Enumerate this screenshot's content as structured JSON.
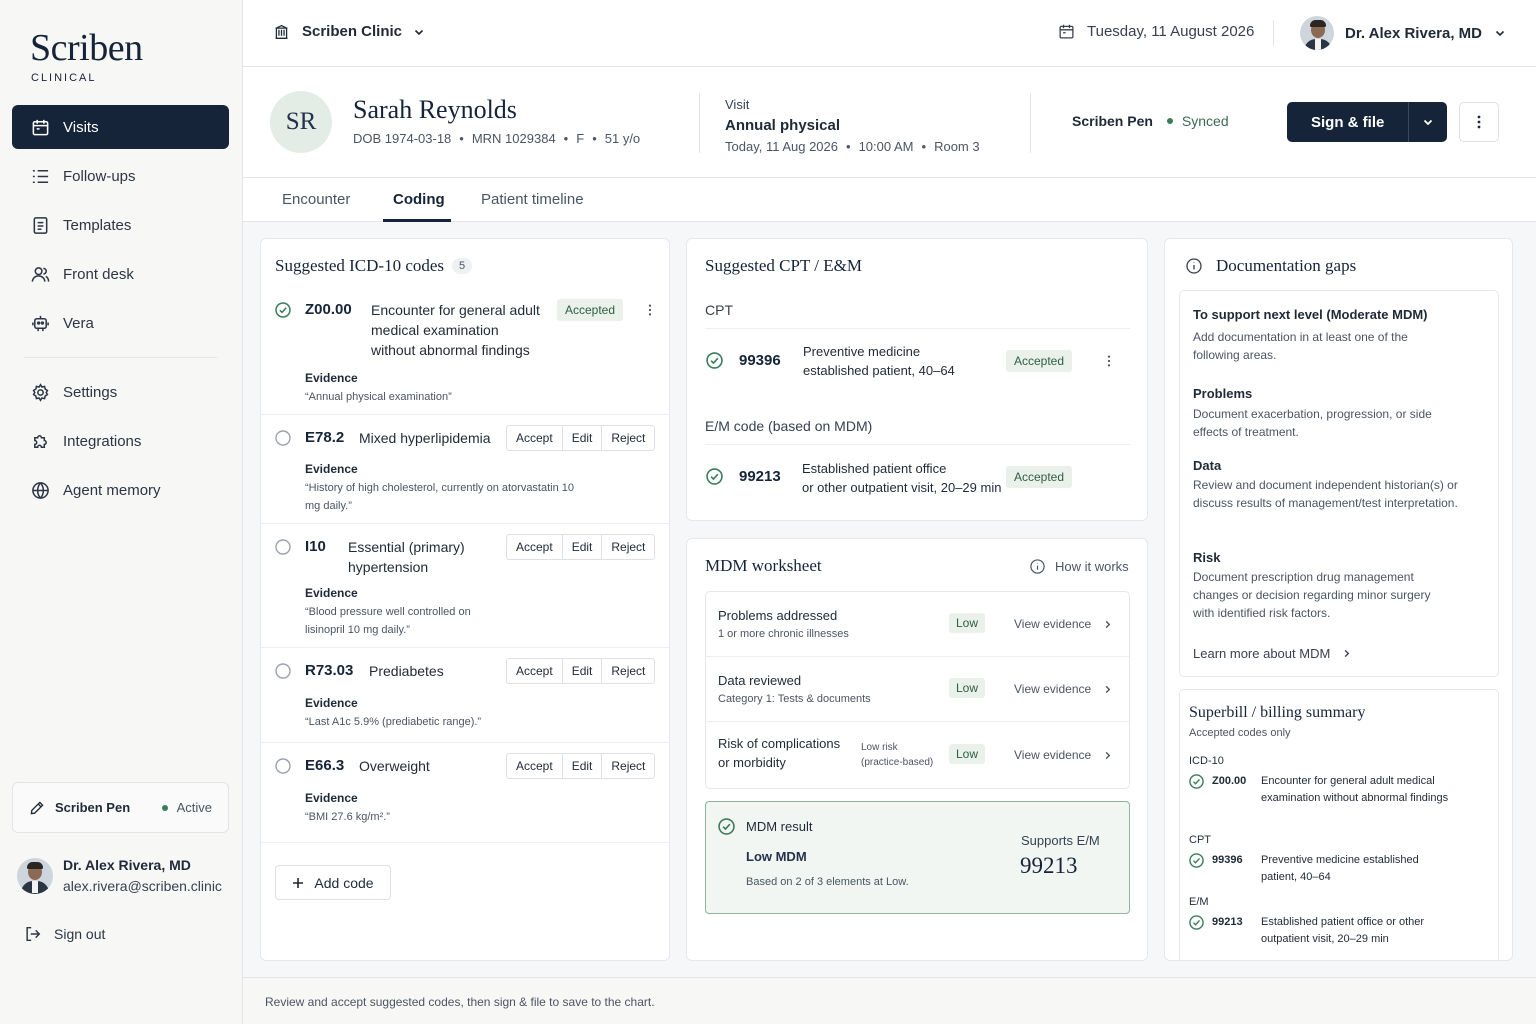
{
  "brand": {
    "name": "Scriben",
    "subtitle": "CLINICAL"
  },
  "sidebar": {
    "items": [
      {
        "label": "Visits",
        "icon": "calendar-icon"
      },
      {
        "label": "Follow-ups",
        "icon": "list-icon"
      },
      {
        "label": "Templates",
        "icon": "document-icon"
      },
      {
        "label": "Front desk",
        "icon": "users-icon"
      },
      {
        "label": "Vera",
        "icon": "robot-icon"
      },
      {
        "label": "Settings",
        "icon": "gear-icon"
      },
      {
        "label": "Integrations",
        "icon": "puzzle-icon"
      },
      {
        "label": "Agent memory",
        "icon": "globe-icon"
      }
    ],
    "pen": {
      "name": "Scriben Pen",
      "status": "Active"
    },
    "user": {
      "name": "Dr. Alex Rivera, MD",
      "email": "alex.rivera@scriben.clinic"
    },
    "signout": "Sign out"
  },
  "topbar": {
    "clinic": "Scriben Clinic",
    "date": "Tuesday, 11 August 2026",
    "user": "Dr. Alex Rivera, MD"
  },
  "patient": {
    "initials": "SR",
    "name": "Sarah Reynolds",
    "dob": "DOB 1974-03-18",
    "mrn": "MRN 1029384",
    "sex": "F",
    "age": "51 y/o",
    "visit_label": "Visit",
    "visit_type": "Annual physical",
    "visit_date": "Today, 11 Aug 2026",
    "visit_time": "10:00 AM",
    "visit_room": "Room 3",
    "pen_name": "Scriben Pen",
    "pen_status": "Synced",
    "sign_label": "Sign & file"
  },
  "tabs": [
    "Encounter",
    "Coding",
    "Patient timeline"
  ],
  "icd": {
    "title": "Suggested ICD-10 codes",
    "count": "5",
    "evidence_label": "Evidence",
    "accepted_label": "Accepted",
    "actions": {
      "accept": "Accept",
      "edit": "Edit",
      "reject": "Reject"
    },
    "add_code": "Add code",
    "codes": [
      {
        "code": "Z00.00",
        "desc": "Encounter for general adult medical examination without abnormal findings",
        "evidence": "“Annual physical examination”"
      },
      {
        "code": "E78.2",
        "desc": "Mixed hyperlipidemia",
        "evidence": "“History of high cholesterol, currently on atorvastatin 10 mg daily.”"
      },
      {
        "code": "I10",
        "desc": "Essential (primary) hypertension",
        "evidence": "“Blood pressure well controlled on lisinopril 10 mg daily.”"
      },
      {
        "code": "R73.03",
        "desc": "Prediabetes",
        "evidence": "“Last A1c 5.9% (prediabetic range).”"
      },
      {
        "code": "E66.3",
        "desc": "Overweight",
        "evidence": "“BMI 27.6 kg/m².”"
      }
    ]
  },
  "cpt": {
    "title": "Suggested CPT / E&M",
    "cpt_label": "CPT",
    "cpt_code": "99396",
    "cpt_desc_1": "Preventive medicine",
    "cpt_desc_2": "established patient, 40–64",
    "em_label": "E/M code (based on MDM)",
    "em_code": "99213",
    "em_desc_1": "Established patient office",
    "em_desc_2": "or other outpatient visit, 20–29 min",
    "accepted_label": "Accepted"
  },
  "mdm": {
    "title": "MDM worksheet",
    "how_it_works": "How it works",
    "view_evidence": "View evidence",
    "rows": [
      {
        "title": "Problems addressed",
        "sub": "1 or more chronic illnesses",
        "level": "Low"
      },
      {
        "title": "Data reviewed",
        "sub": "Category 1: Tests & documents",
        "level": "Low"
      },
      {
        "title_1": "Risk of complications",
        "title_2": "or morbidity",
        "note_1": "Low risk",
        "note_2": "(practice-based)",
        "level": "Low"
      }
    ],
    "result_label": "MDM result",
    "result_level": "Low MDM",
    "result_note": "Based on 2 of 3 elements at Low.",
    "supports_label": "Supports E/M",
    "supports_code": "99213"
  },
  "gaps": {
    "title": "Documentation gaps",
    "heading": "To support next level (Moderate MDM)",
    "intro": "Add documentation in at least one of the following areas.",
    "items": [
      {
        "h": "Problems",
        "t": "Document exacerbation, progression, or side effects of treatment."
      },
      {
        "h": "Data",
        "t": "Review and document independent historian(s) or discuss results of management/test interpretation."
      },
      {
        "h": "Risk",
        "t": "Document prescription drug management changes or decision regarding minor surgery with identified risk factors."
      }
    ],
    "learn_more": "Learn more about MDM"
  },
  "billing": {
    "title": "Superbill / billing summary",
    "sub": "Accepted codes only",
    "groups": [
      {
        "cat": "ICD-10",
        "code": "Z00.00",
        "desc": "Encounter for general adult medical examination without abnormal findings"
      },
      {
        "cat": "CPT",
        "code": "99396",
        "desc": "Preventive medicine established patient, 40–64"
      },
      {
        "cat": "E/M",
        "code": "99213",
        "desc": "Established patient office or other outpatient visit, 20–29 min"
      }
    ]
  },
  "footer": "Review and accept suggested codes, then sign & file to save to the chart.",
  "colors": {
    "navy": "#16243a",
    "accent_green": "#3a7d5a",
    "pill_bg": "#e9f1ea"
  }
}
